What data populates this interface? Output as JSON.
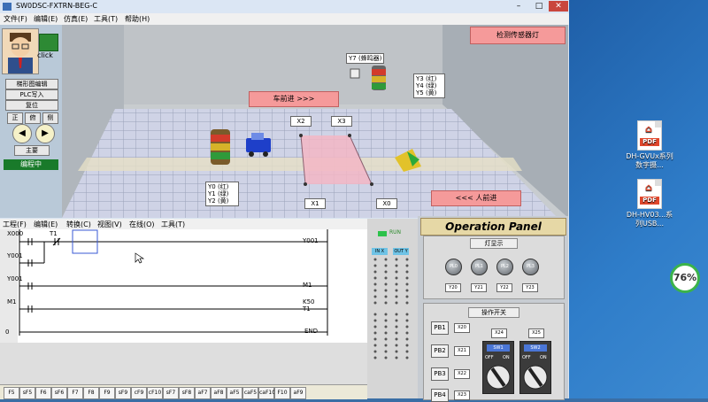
{
  "window": {
    "title": "SW0DSC-FXTRN-BEG-C",
    "controls": [
      "–",
      "□",
      "✕"
    ]
  },
  "menu": [
    "文件(F)",
    "编辑(E)",
    "仿真(E)",
    "工具(T)",
    "帮助(H)"
  ],
  "left_panel": {
    "click_label": "click",
    "buttons": [
      "梯形图编辑",
      "PLC写入",
      "复位"
    ],
    "small_buttons": [
      "正",
      "俯",
      "侧"
    ],
    "main_button": "主要",
    "status": "编程中"
  },
  "scene": {
    "detect_button": "检测传感器灯",
    "car_forward": "车前进 >>>",
    "person_forward": "<<< 人前进",
    "buzzer": "Y7 (蜂鸣器)",
    "tower_light_labels": [
      "Y3 (红)",
      "Y4 (绿)",
      "Y5 (黄)"
    ],
    "cone_labels": [
      "Y0 (红)",
      "Y1 (绿)",
      "Y2 (黄)"
    ],
    "sensors": [
      "X2",
      "X3",
      "X1",
      "X0"
    ]
  },
  "ladder": {
    "toolbar": [
      "工程(F)",
      "编辑(E)",
      "转换(C)",
      "视图(V)",
      "在线(O)",
      "工具(T)"
    ],
    "rows": [
      {
        "step": "",
        "contacts": [
          "X000",
          "T1"
        ],
        "coil": "Y001"
      },
      {
        "step": "",
        "contacts": [
          "Y001"
        ],
        "coil": ""
      },
      {
        "step": "",
        "contacts": [
          "Y001"
        ],
        "coil": "M1"
      },
      {
        "step": "",
        "contacts": [
          "M1"
        ],
        "coil": "T1",
        "setting": "K50"
      },
      {
        "step": "0",
        "contacts": [],
        "coil": "END"
      }
    ],
    "function_keys": [
      "F5",
      "sF5",
      "F6",
      "sF6",
      "F7",
      "F8",
      "F9",
      "sF9",
      "cF9",
      "cF10",
      "sF7",
      "sF8",
      "aF7",
      "aF8",
      "aF5",
      "caF5",
      "caF10",
      "F10",
      "aF9"
    ]
  },
  "io": {
    "run_label": "RUN",
    "in_label": "IN X",
    "out_label": "OUT Y"
  },
  "operation_panel": {
    "title": "Operation Panel",
    "lamp_section": "灯显示",
    "lamps": [
      {
        "name": "PL0",
        "addr": "Y20"
      },
      {
        "name": "PL1",
        "addr": "Y21"
      },
      {
        "name": "PL2",
        "addr": "Y22"
      },
      {
        "name": "PL3",
        "addr": "Y23"
      }
    ],
    "switch_section": "操作开关",
    "push_buttons": [
      {
        "name": "PB1",
        "addr": "X20"
      },
      {
        "name": "PB2",
        "addr": "X21"
      },
      {
        "name": "PB3",
        "addr": "X22"
      },
      {
        "name": "PB4",
        "addr": "X23"
      }
    ],
    "selector_addrs": [
      "X24",
      "X25"
    ],
    "selectors": [
      {
        "name": "SW1",
        "off": "OFF",
        "on": "ON"
      },
      {
        "name": "SW2",
        "off": "OFF",
        "on": "ON"
      }
    ]
  },
  "desktop": {
    "files": [
      {
        "name": "DH-GVUx系列数字摄...",
        "type": "PDF"
      },
      {
        "name": "DH-HV03...系列USB...",
        "type": "PDF"
      }
    ],
    "progress": "76%"
  },
  "colors": {
    "accent_red": "#f59a9a",
    "status_green": "#197a2a",
    "desktop_blue": "#2f7dc9"
  }
}
